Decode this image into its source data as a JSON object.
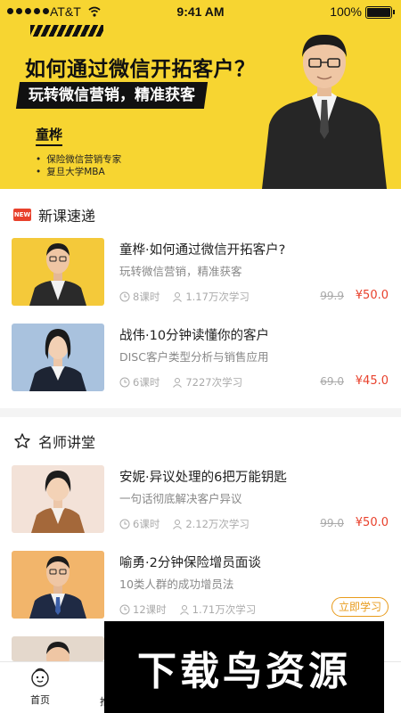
{
  "status_bar": {
    "carrier": "AT&T",
    "time": "9:41 AM",
    "battery": "100%"
  },
  "hero": {
    "title": "如何通过微信开拓客户？",
    "banner": "玩转微信营销，精准获客",
    "teacher": "童桦",
    "bullets": [
      "保险微信营销专家",
      "复旦大学MBA"
    ]
  },
  "sections": {
    "new_courses": {
      "badge": "NEW",
      "label": "新课速递"
    },
    "masters": {
      "label": "名师讲堂"
    }
  },
  "courses": [
    {
      "title": "童桦·如何通过微信开拓客户?",
      "subtitle": "玩转微信营销，精准获客",
      "lessons": "8课时",
      "learners": "1.17万次学习",
      "old_price": "99.9",
      "price": "¥50.0",
      "thumb_bg": "#f4c93a"
    },
    {
      "title": "战伟·10分钟读懂你的客户",
      "subtitle": "DISC客户类型分析与销售应用",
      "lessons": "6课时",
      "learners": "7227次学习",
      "old_price": "69.0",
      "price": "¥45.0",
      "thumb_bg": "#a9c2de"
    },
    {
      "title": "安妮·异议处理的6把万能钥匙",
      "subtitle": "一句话彻底解决客户异议",
      "lessons": "6课时",
      "learners": "2.12万次学习",
      "old_price": "99.0",
      "price": "¥50.0",
      "thumb_bg": "#f3e2d8"
    },
    {
      "title": "喻勇·2分钟保险增员面谈",
      "subtitle": "10类人群的成功增员法",
      "lessons": "12课时",
      "learners": "1.71万次学习",
      "action": "立即学习",
      "thumb_bg": "#f2b56b"
    }
  ],
  "tabbar": {
    "home": "首页",
    "next_partial": "推"
  },
  "watermark": "下载鸟资源",
  "colors": {
    "brand_yellow": "#f7d531",
    "price_red": "#e8412c",
    "action_orange": "#e89b1b"
  }
}
